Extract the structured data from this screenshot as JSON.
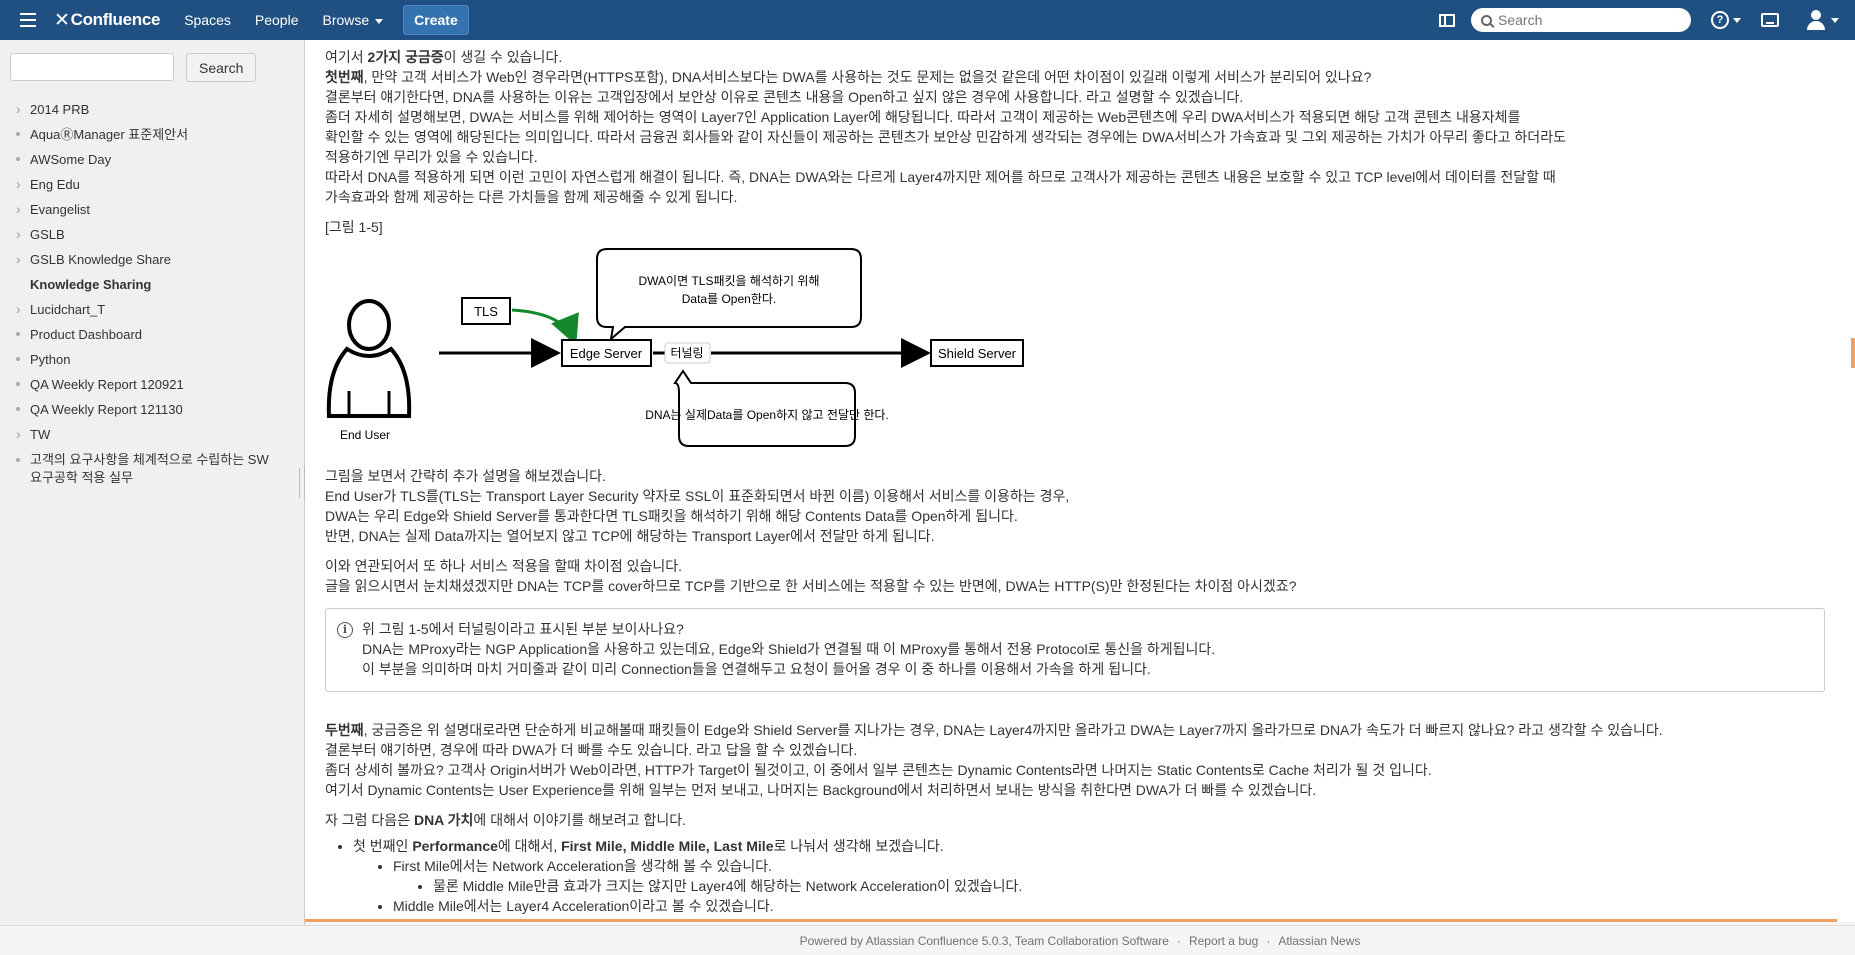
{
  "header": {
    "logo": "Confluence",
    "nav": [
      "Spaces",
      "People",
      "Browse"
    ],
    "create": "Create",
    "search_placeholder": "Search"
  },
  "sidebar": {
    "search_button": "Search",
    "items": [
      {
        "label": "2014 PRB",
        "marker": "chevron"
      },
      {
        "label": "AquaⓇManager 표준제안서",
        "marker": "bullet"
      },
      {
        "label": "AWSome Day",
        "marker": "bullet"
      },
      {
        "label": "Eng Edu",
        "marker": "chevron"
      },
      {
        "label": "Evangelist",
        "marker": "chevron"
      },
      {
        "label": "GSLB",
        "marker": "chevron"
      },
      {
        "label": "GSLB Knowledge Share",
        "marker": "chevron"
      },
      {
        "label": "Knowledge Sharing",
        "marker": "none"
      },
      {
        "label": "Lucidchart_T",
        "marker": "chevron"
      },
      {
        "label": "Product Dashboard",
        "marker": "bullet"
      },
      {
        "label": "Python",
        "marker": "bullet"
      },
      {
        "label": "QA Weekly Report 120921",
        "marker": "bullet"
      },
      {
        "label": "QA Weekly Report 121130",
        "marker": "bullet"
      },
      {
        "label": "TW",
        "marker": "chevron"
      },
      {
        "label": "고객의 요구사항을 체계적으로 수립하는 SW 요구공학 적용 실무",
        "marker": "bullet"
      }
    ]
  },
  "content": {
    "p1_pre": "여기서 ",
    "p1_b": "2가지 궁금증",
    "p1_post": "이 생길 수 있습니다.",
    "p2_b": "첫번째",
    "p2_post": ", 만약 고객 서비스가 Web인 경우라면(HTTPS포함), DNA서비스보다는 DWA를 사용하는 것도 문제는 없을것 같은데 어떤 차이점이 있길래 이렇게 서비스가 분리되어 있나요?",
    "p3": "결론부터 얘기한다면, DNA를 사용하는 이유는 고객입장에서 보안상 이유로 콘텐츠 내용을 Open하고 싶지 않은 경우에 사용합니다. 라고 설명할 수 있겠습니다.",
    "p4": "좀더 자세히 설명해보면, DWA는 서비스를 위해 제어하는 영역이 Layer7인 Application Layer에 해당됩니다. 따라서 고객이 제공하는 Web콘텐츠에 우리 DWA서비스가 적용되면 해당 고객 콘텐츠 내용자체를",
    "p5": "확인할 수 있는 영역에 해당된다는 의미입니다. 따라서 금융권 회사들와 같이 자신들이 제공하는 콘텐츠가 보안상 민감하게 생각되는 경우에는 DWA서비스가 가속효과 및 그외 제공하는 가치가 아무리 좋다고 하더라도",
    "p6": "적용하기엔 무리가 있을 수 있습니다.",
    "p7": "따라서 DNA를 적용하게 되면 이런 고민이 자연스럽게 해결이 됩니다. 즉, DNA는 DWA와는 다르게 Layer4까지만 제어를 하므로 고객사가 제공하는 콘텐츠 내용은 보호할 수 있고 TCP level에서 데이터를 전달할 때",
    "p8": "가속효과와 함께 제공하는 다른 가치들을 함께 제공해줄 수 있게 됩니다.",
    "fig_caption": "[그림 1-5]",
    "diagram": {
      "tls": "TLS",
      "end_user": "End User",
      "edge": "Edge Server",
      "tunnel": "터널링",
      "shield": "Shield Server",
      "bubble_top_1": "DWA이면 TLS패킷을 해석하기 위해",
      "bubble_top_2": "Data를 Open한다.",
      "bubble_bottom": "DNA는 실제Data를 Open하지 않고 전달만 한다."
    },
    "q1": "그림을 보면서 간략히 추가 설명을 해보겠습니다.",
    "q2": "End User가 TLS를(TLS는 Transport Layer Security 약자로 SSL이 표준화되면서 바뀐 이름) 이용해서 서비스를 이용하는 경우,",
    "q3": "DWA는 우리 Edge와 Shield Server를 통과한다면 TLS패킷을 해석하기 위해 해당 Contents Data를 Open하게 됩니다.",
    "q4": "반면, DNA는 실제 Data까지는 열어보지 않고 TCP에 해당하는 Transport Layer에서 전달만 하게 됩니다.",
    "r1": "이와 연관되어서 또 하나 서비스 적용을 할때 차이점 있습니다.",
    "r2": "글을 읽으시면서 눈치채셨겠지만 DNA는 TCP를 cover하므로 TCP를 기반으로 한 서비스에는 적용할 수 있는 반면에, DWA는 HTTP(S)만 한정된다는 차이점 아시겠죠?",
    "info1": "위 그림 1-5에서 터널링이라고 표시된 부분 보이사나요?",
    "info2": "DNA는 MProxy라는 NGP Application을 사용하고 있는데요, Edge와 Shield가 연결될 때 이 MProxy를 통해서 전용 Protocol로 통신을 하게됩니다.",
    "info3": "이 부분을 의미하며 마치 거미줄과 같이 미리 Connection들을 연결해두고 요청이 들어올 경우 이 중 하나를 이용해서 가속을 하게 됩니다.",
    "s1_b": "두번째",
    "s1_post": ", 궁금증은 위 설명대로라면 단순하게 비교해볼때 패킷들이 Edge와 Shield Server를 지나가는 경우, DNA는 Layer4까지만 올라가고 DWA는 Layer7까지 올라가므로 DNA가 속도가 더 빠르지 않나요? 라고 생각할 수 있습니다.",
    "s2": "결론부터 얘기하면, 경우에 따라 DWA가 더 빠를 수도 있습니다. 라고 답을 할 수 있겠습니다.",
    "s3": "좀더 상세히 볼까요? 고객사 Origin서버가 Web이라면, HTTP가 Target이 될것이고, 이 중에서 일부 콘텐츠는 Dynamic Contents라면 나머지는 Static Contents로 Cache 처리가 될 것 입니다.",
    "s4": "여기서 Dynamic Contents는 User Experience를 위해 일부는 먼저 보내고, 나머지는 Background에서 처리하면서 보내는 방식을 취한다면 DWA가 더 빠를 수 있겠습니다.",
    "t1_pre": "자 그럼 다음은 ",
    "t1_b": "DNA 가치",
    "t1_post": "에 대해서 이야기를 해보려고 합니다.",
    "l1_pre": "첫 번째인 ",
    "l1_b1": "Performance",
    "l1_mid": "에 대해서, ",
    "l1_b2": "First Mile, Middle Mile, Last Mile",
    "l1_post": "로 나눠서 생각해 보겠습니다.",
    "l2": "First Mile에서는 Network Acceleration을 생각해 볼 수 있습니다.",
    "l3": "물론 Middle Mile만큼 효과가 크지는 않지만 Layer4에 해당하는 Network Acceleration이 있겠습니다.",
    "l4": "Middle Mile에서는 Layer4 Acceleration이라고 볼 수 있겠습니다."
  },
  "footer": {
    "powered": "Powered by Atlassian Confluence 5.0.3, Team Collaboration Software",
    "sep": "·",
    "report": "Report a bug",
    "news": "Atlassian News"
  },
  "colors": {
    "header_bg": "#205081",
    "create_btn": "#3572b0",
    "tls_arrow": "#14892c"
  }
}
